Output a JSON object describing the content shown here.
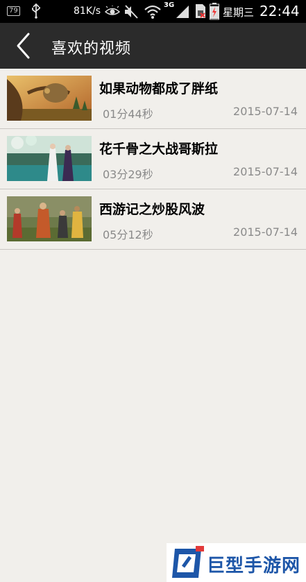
{
  "status_bar": {
    "battery_level": "79",
    "net_speed": "81K/s",
    "network_type": "3G",
    "date": "星期三",
    "time": "22:44"
  },
  "header": {
    "title": "喜欢的视频"
  },
  "videos": [
    {
      "title": "如果动物都成了胖纸",
      "duration": "01分44秒",
      "date": "2015-07-14"
    },
    {
      "title": "花千骨之大战哥斯拉",
      "duration": "03分29秒",
      "date": "2015-07-14"
    },
    {
      "title": "西游记之炒股风波",
      "duration": "05分12秒",
      "date": "2015-07-14"
    }
  ],
  "watermark": {
    "text": "巨型手游网"
  },
  "colors": {
    "background": "#f1efeb",
    "title_bar": "#2b2b2b",
    "status_bar": "#000000",
    "secondary_text": "#8a8a8a",
    "watermark_blue": "#1d56a8"
  }
}
